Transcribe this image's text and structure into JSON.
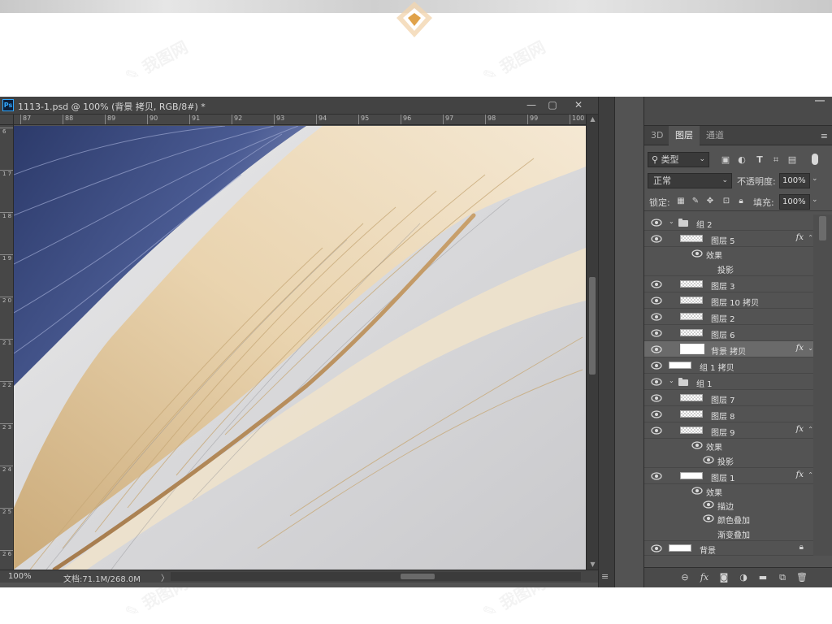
{
  "document": {
    "title": "1113-1.psd @ 100% (背景 拷贝, RGB/8#) *",
    "ps_logo": "Ps",
    "window_buttons": {
      "minimize": "—",
      "restore": "▢",
      "close": "✕"
    },
    "ruler_top": [
      "87",
      "88",
      "89",
      "90",
      "91",
      "92",
      "93",
      "94",
      "95",
      "96",
      "97",
      "98",
      "99",
      "100"
    ],
    "ruler_left": [
      "6",
      "1 7",
      "1 8",
      "1 9",
      "2 0",
      "2 1",
      "2 2",
      "2 3",
      "2 4",
      "2 5",
      "2 6"
    ],
    "status": {
      "zoom": "100%",
      "doc_info": "文档:71.1M/268.0M",
      "arrow": "〉"
    }
  },
  "panel": {
    "tabs": [
      {
        "label": "3D",
        "active": false
      },
      {
        "label": "图层",
        "active": true
      },
      {
        "label": "通道",
        "active": false
      }
    ],
    "menu_icon": "≡",
    "filter": {
      "label": "类型",
      "icons": [
        "image-filter-icon",
        "adjustment-filter-icon",
        "type-filter-icon",
        "shape-filter-icon",
        "smart-object-filter-icon"
      ]
    },
    "blend_mode": "正常",
    "opacity_label": "不透明度:",
    "opacity_value": "100%",
    "lock_label": "锁定:",
    "fill_label": "填充:",
    "fill_value": "100%",
    "layers": [
      {
        "name": "组 2",
        "kind": "group"
      },
      {
        "name": "图层 5",
        "kind": "layer",
        "fx": "fx"
      },
      {
        "name": "效果",
        "kind": "effect-header"
      },
      {
        "name": "投影",
        "kind": "effect"
      },
      {
        "name": "图层 3",
        "kind": "layer"
      },
      {
        "name": "图层 10 拷贝",
        "kind": "layer"
      },
      {
        "name": "图层 2",
        "kind": "layer"
      },
      {
        "name": "图层 6",
        "kind": "layer"
      },
      {
        "name": "背景 拷贝",
        "kind": "layer",
        "fx": "fx",
        "selected": true
      },
      {
        "name": "组 1 拷贝",
        "kind": "layer"
      },
      {
        "name": "组 1",
        "kind": "group"
      },
      {
        "name": "图层 7",
        "kind": "layer"
      },
      {
        "name": "图层 8",
        "kind": "layer"
      },
      {
        "name": "图层 9",
        "kind": "layer",
        "fx": "fx"
      },
      {
        "name": "效果",
        "kind": "effect-header"
      },
      {
        "name": "投影",
        "kind": "effect"
      },
      {
        "name": "图层 1",
        "kind": "layer",
        "fx": "fx"
      },
      {
        "name": "效果",
        "kind": "effect-header"
      },
      {
        "name": "描边",
        "kind": "effect"
      },
      {
        "name": "颜色叠加",
        "kind": "effect"
      },
      {
        "name": "渐变叠加",
        "kind": "effect"
      },
      {
        "name": "背景",
        "kind": "background"
      }
    ],
    "bottom_icons": [
      "link-layers-icon",
      "fx-icon",
      "mask-icon",
      "adjustment-icon",
      "new-group-icon",
      "new-layer-icon",
      "delete-icon"
    ]
  },
  "colors": {
    "panel_bg": "#535353",
    "accent_blue": "#31a8ff",
    "feather_gold": "#d7b98a",
    "feather_navy": "#3a4a7a"
  }
}
